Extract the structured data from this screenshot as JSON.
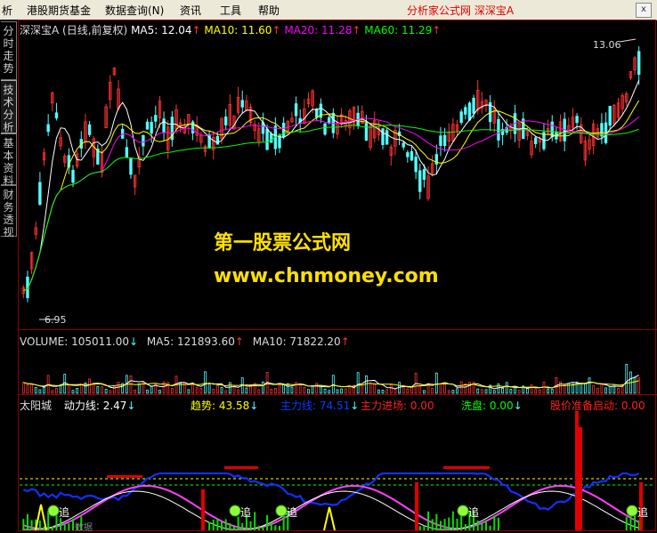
{
  "menu": {
    "items": [
      "析",
      "港股期货基金",
      "数据查询(N)",
      "资讯",
      "工具",
      "帮助"
    ],
    "right_title": "分析家公式网 深深宝A",
    "close": "x"
  },
  "sidebar": {
    "tabs": [
      "分时走势",
      "技术分析",
      "基本资料",
      "财务透视"
    ]
  },
  "main_panel": {
    "stock_name": "深深宝A",
    "period": "(日线,前复权)",
    "ma": [
      {
        "label": "MA5: 12.04",
        "color": "#FFFFFF"
      },
      {
        "label": "MA10: 11.60",
        "color": "#FFFF00"
      },
      {
        "label": "MA20: 11.28",
        "color": "#FF00FF"
      },
      {
        "label": "MA60: 11.29",
        "color": "#00FF00"
      }
    ],
    "high_label": "13.06",
    "low_label": "6.95"
  },
  "volume_panel": {
    "volume": "VOLUME: 105011.00",
    "ma5": "MA5: 121893.60",
    "ma10": "MA10: 71822.20"
  },
  "indicator_panel": {
    "name": "太阳城",
    "items": [
      {
        "label": "动力线: 2.47",
        "color": "#FFFFFF"
      },
      {
        "label": "趋势: 43.58",
        "color": "#FFFF00"
      },
      {
        "label": "主力线: 74.51",
        "color": "#0040FF"
      },
      {
        "label": "主力进场: 0.00",
        "color": "#FF2020"
      },
      {
        "label": "洗盘: 0.00",
        "color": "#00FF00"
      },
      {
        "label": "股价准备启动: 0.00",
        "color": "#FF2020"
      }
    ],
    "marks": [
      "追",
      "追",
      "追",
      "追",
      "追",
      "追"
    ],
    "bottom_label": "数据"
  },
  "watermark": {
    "line1": "第一股票公式网",
    "line2": "www.chnmoney.com"
  },
  "colors": {
    "up": "#FF3232",
    "down": "#54FCFC",
    "ma5": "#FFFFFF",
    "ma10": "#FFFF00",
    "ma20": "#FF00FF",
    "ma60": "#00FF00",
    "grid": "#8B0000"
  }
}
